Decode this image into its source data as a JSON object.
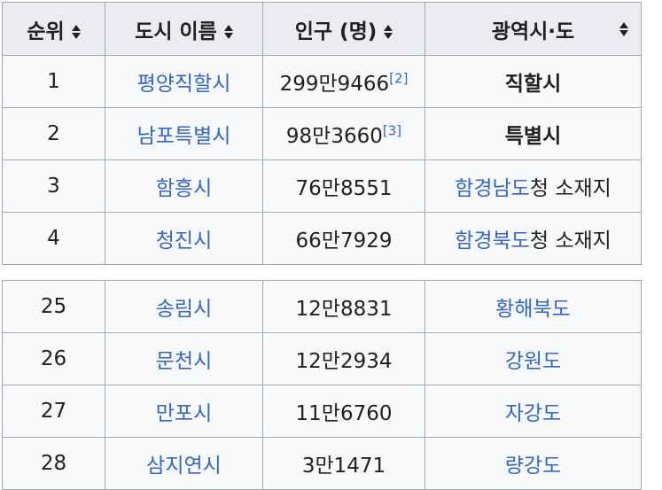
{
  "table": {
    "headers": [
      "순위",
      "도시 이름",
      "인구 (명)",
      "광역시·도"
    ],
    "rows_top": [
      {
        "rank": "1",
        "city": "평양직할시",
        "population": "299만9466",
        "ref": "[2]",
        "province": "직할시",
        "province_link": "",
        "province_suffix": ""
      },
      {
        "rank": "2",
        "city": "남포특별시",
        "population": "98만3660",
        "ref": "[3]",
        "province": "특별시",
        "province_link": "",
        "province_suffix": ""
      },
      {
        "rank": "3",
        "city": "함흥시",
        "population": "76만8551",
        "ref": "",
        "province": "",
        "province_link": "함경남도",
        "province_suffix": "청 소재지"
      },
      {
        "rank": "4",
        "city": "청진시",
        "population": "66만7929",
        "ref": "",
        "province": "",
        "province_link": "함경북도",
        "province_suffix": "청 소재지"
      }
    ],
    "rows_bottom": [
      {
        "rank": "25",
        "city": "송림시",
        "population": "12만8831",
        "province_link": "황해북도"
      },
      {
        "rank": "26",
        "city": "문천시",
        "population": "12만2934",
        "province_link": "강원도"
      },
      {
        "rank": "27",
        "city": "만포시",
        "population": "11만6760",
        "province_link": "자강도"
      },
      {
        "rank": "28",
        "city": "삼지연시",
        "population": "3만1471",
        "province_link": "량강도"
      }
    ]
  },
  "colors": {
    "link": "#3366cc",
    "header_bg": "#eaecf0",
    "cell_bg": "#f8f9fa",
    "border": "#a2a9b1"
  },
  "icons": {
    "sort": "sort-updown-icon"
  }
}
